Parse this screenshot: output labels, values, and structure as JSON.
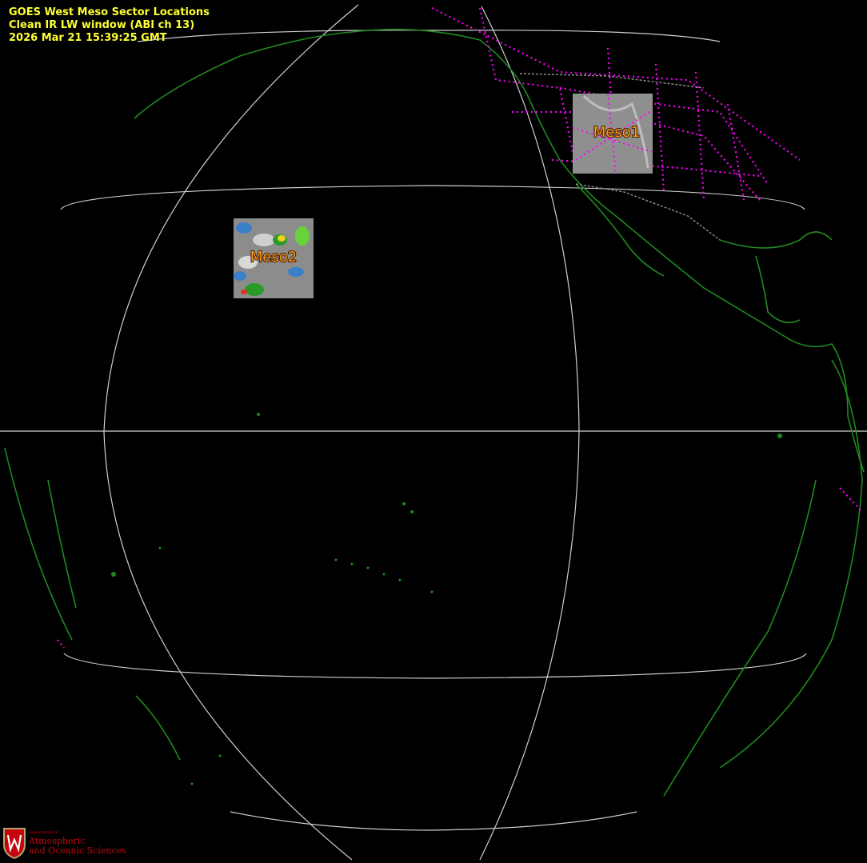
{
  "header": {
    "line1": "GOES West Meso Sector Locations",
    "line2": "Clean IR LW window (ABI ch 13)",
    "line3": "2026 Mar 21  15:39:25 GMT"
  },
  "sectors": [
    {
      "label": "Meso1"
    },
    {
      "label": "Meso2"
    }
  ],
  "logo": {
    "dept": "Department of",
    "line1": "Atmospheric",
    "line2": "and Oceanic Sciences"
  },
  "colors": {
    "text": "#ffff33",
    "coastline": "#1f8a1f",
    "state_borders": "#ff00ff",
    "grid": "#cfcfcf",
    "meso_label": "#ff9a1a",
    "logo_red": "#c5050c"
  }
}
